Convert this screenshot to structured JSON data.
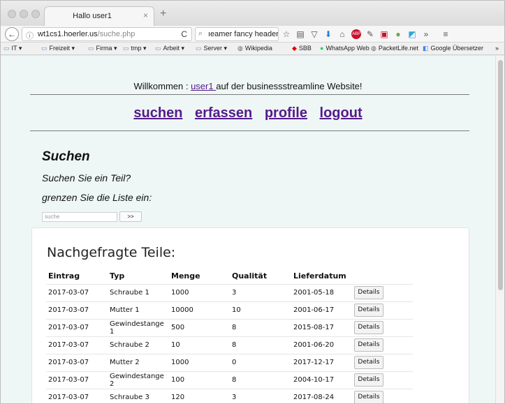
{
  "browser": {
    "tab_title": "Hallo user1",
    "tab_close": "×",
    "new_tab": "+",
    "back": "←",
    "url_host": "wt1cs1.hoerler.us",
    "url_path": "/suche.php",
    "reload": "C",
    "search_value": "ıeamer fancy header →",
    "bookmarks": [
      {
        "label": "IT ▾"
      },
      {
        "label": "Freizeit ▾"
      },
      {
        "label": "Firma ▾"
      },
      {
        "label": "tmp ▾"
      },
      {
        "label": "Arbeit ▾"
      },
      {
        "label": "Server ▾"
      },
      {
        "label": "Wikipedia"
      },
      {
        "label": "SBB"
      },
      {
        "label": "WhatsApp Web"
      },
      {
        "label": "PacketLife.net"
      },
      {
        "label": "Google Übersetzer"
      }
    ],
    "overflow": "»"
  },
  "header": {
    "welcome_prefix": "Willkommen : ",
    "user_link": "user1 ",
    "welcome_suffix": "auf der businessstreamline Website!"
  },
  "nav": {
    "items": [
      {
        "label": "suchen "
      },
      {
        "label": "erfassen "
      },
      {
        "label": "profile "
      },
      {
        "label": "logout"
      }
    ]
  },
  "search": {
    "heading": "Suchen",
    "question": "Suchen Sie ein Teil?",
    "hint": "grenzen Sie die Liste ein:",
    "placeholder": "suche",
    "button": ">>"
  },
  "results": {
    "title": "Nachgefragte Teile:",
    "columns": [
      "Eintrag",
      "Typ",
      "Menge",
      "Qualität",
      "Lieferdatum"
    ],
    "details_label": "Details",
    "rows": [
      [
        "2017-03-07",
        "Schraube 1",
        "1000",
        "3",
        "2001-05-18"
      ],
      [
        "2017-03-07",
        "Mutter 1",
        "10000",
        "10",
        "2001-06-17"
      ],
      [
        "2017-03-07",
        "Gewindestange 1",
        "500",
        "8",
        "2015-08-17"
      ],
      [
        "2017-03-07",
        "Schraube 2",
        "10",
        "8",
        "2001-06-20"
      ],
      [
        "2017-03-07",
        "Mutter 2",
        "1000",
        "0",
        "2017-12-17"
      ],
      [
        "2017-03-07",
        "Gewindestange 2",
        "100",
        "8",
        "2004-10-17"
      ],
      [
        "2017-03-07",
        "Schraube 3",
        "120",
        "3",
        "2017-08-24"
      ]
    ]
  }
}
